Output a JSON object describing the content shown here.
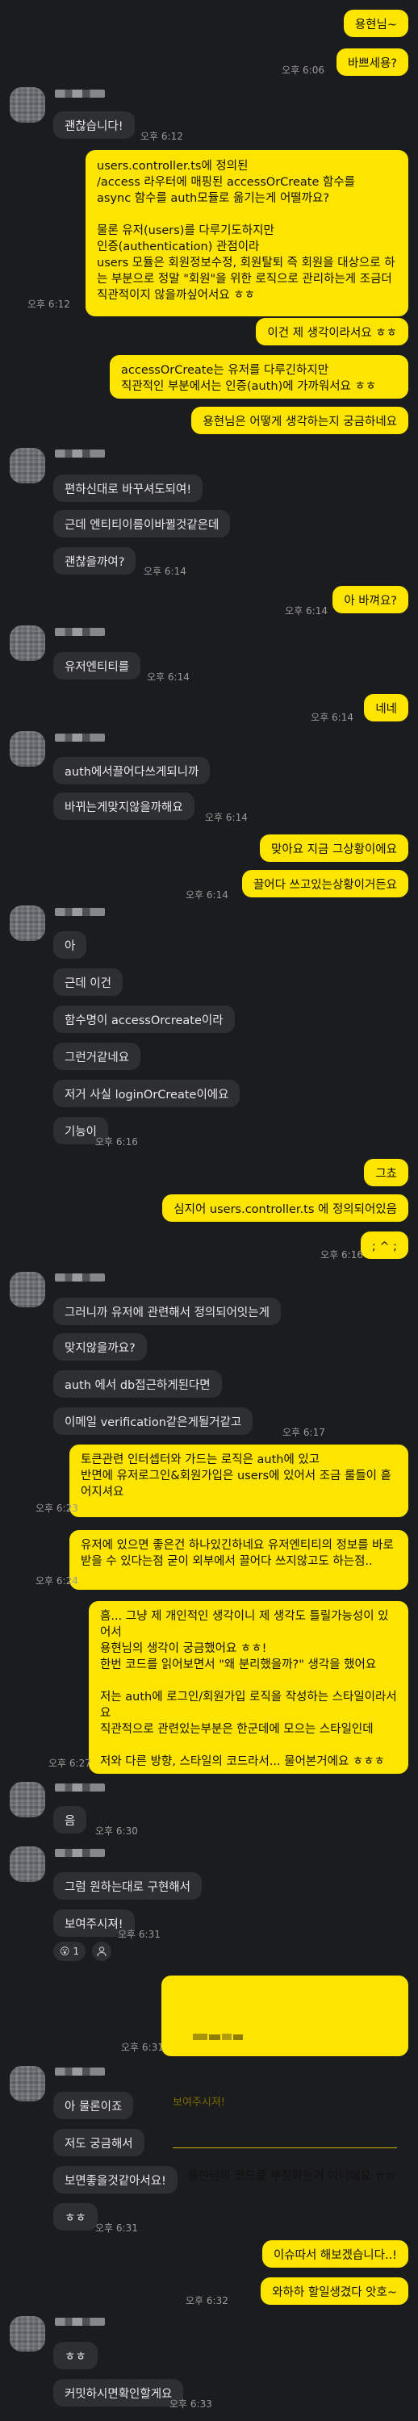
{
  "messages": [
    {
      "sender": "me",
      "text": "용현님~"
    },
    {
      "sender": "me",
      "text": "바쁘세용?",
      "time": "오후 6:06"
    },
    {
      "sender": "them",
      "text": "괜찮습니다!",
      "time": "오후 6:12"
    },
    {
      "sender": "me",
      "text": "users.controller.ts에 정의된\n/access 라우터에 매핑된 accessOrCreate 함수를\nasync 함수를 auth모듈로 옮기는게 어떨까요?\n\n물론 유저(users)를 다루기도하지만\n인증(authentication) 관점이라\nusers 모듈은 회원정보수정, 회원탈퇴 즉 회원을 대상으로 하는 부분으로 정말 \"회원\"을 위한 로직으로 관리하는게 조금더 직관적이지 않을까싶어서요 ㅎㅎ",
      "time": "오후 6:12"
    },
    {
      "sender": "me",
      "text": "이건 제 생각이라서요 ㅎㅎ"
    },
    {
      "sender": "me",
      "text": "accessOrCreate는 유저를 다루긴하지만\n직관적인 부분에서는 인증(auth)에 가까워서요 ㅎㅎ"
    },
    {
      "sender": "me",
      "text": "용현님은 어떻게 생각하는지 궁금하네요"
    },
    {
      "sender": "them",
      "text": "편하신대로 바꾸셔도되여!"
    },
    {
      "sender": "them",
      "text": "근데 엔티티이름이바뀔것같은데"
    },
    {
      "sender": "them",
      "text": "괜찮을까여?",
      "time": "오후 6:14"
    },
    {
      "sender": "me",
      "text": "아 바껴요?",
      "time": "오후 6:14"
    },
    {
      "sender": "them",
      "text": "유저엔티티를",
      "time": "오후 6:14"
    },
    {
      "sender": "me",
      "text": "네네",
      "time": "오후 6:14"
    },
    {
      "sender": "them",
      "text": "auth에서끌어다쓰게되니까"
    },
    {
      "sender": "them",
      "text": "바뀌는게맞지않을까해요",
      "time": "오후 6:14"
    },
    {
      "sender": "me",
      "text": "맞아요 지금 그상황이에요"
    },
    {
      "sender": "me",
      "text": "끌어다 쓰고있는상황이거든요",
      "time": "오후 6:14"
    },
    {
      "sender": "them",
      "text": "아"
    },
    {
      "sender": "them",
      "text": "근데 이건"
    },
    {
      "sender": "them",
      "text": "함수명이 accessOrcreate이라"
    },
    {
      "sender": "them",
      "text": "그런거같네요"
    },
    {
      "sender": "them",
      "text": "저거 사실 loginOrCreate이에요"
    },
    {
      "sender": "them",
      "text": "기능이",
      "time": "오후 6:16"
    },
    {
      "sender": "me",
      "text": "그쵸"
    },
    {
      "sender": "me",
      "text": "심지어 users.controller.ts 에 정의되어있음"
    },
    {
      "sender": "me",
      "text": "; ^ ;",
      "time": "오후 6:16"
    },
    {
      "sender": "them",
      "text": "그러니까 유저에 관련해서 정의되어잇는게"
    },
    {
      "sender": "them",
      "text": "맞지않을까요?"
    },
    {
      "sender": "them",
      "text": "auth 에서 db접근하게된다면"
    },
    {
      "sender": "them",
      "text": "이메일 verification같은게될거같고",
      "time": "오후 6:17"
    },
    {
      "sender": "me",
      "text": "토큰관련 인터셉터와 가드는 로직은 auth에 있고\n반면에 유저로그인&회원가입은 users에 있어서 조금 룰들이 흩어지셔요",
      "time": "오후 6:23"
    },
    {
      "sender": "me",
      "text": "유저에 있으면 좋은건 하나있긴하네요 유저엔티티의 정보를 바로 받을 수 있다는점 굳이 외부에서 끌어다 쓰지않고도 하는점..",
      "time": "오후 6:24"
    },
    {
      "sender": "me",
      "text": "흠... 그냥 제 개인적인 생각이니 제 생각도 틀릴가능성이 있어서\n용현님의 생각이 궁금했어요 ㅎㅎ!\n한번 코드를 읽어보면서 \"왜 분리했을까?\" 생각을 했어요\n\n저는 auth에 로그인/회원가입 로직을 작성하는 스타일이라서요\n직관적으로 관련있는부분은 한군데에 모으는 스타일인데\n\n저와 다른 방향, 스타일의 코드라서... 물어본거에요 ㅎㅎㅎ",
      "time": "오후 6:27"
    },
    {
      "sender": "them",
      "text": "음",
      "time": "오후 6:30"
    },
    {
      "sender": "them",
      "text": "그럼 원하는대로 구현해서"
    },
    {
      "sender": "them",
      "text": "보여주시져!",
      "time": "오후 6:31"
    },
    {
      "sender": "me",
      "quote_sub": "보여주시져!",
      "text": "용현님의 코드를 부정하는거 아니에요 ㅠㅠ",
      "time": "오후 6:31"
    },
    {
      "sender": "them",
      "text": "아 물론이죠"
    },
    {
      "sender": "them",
      "text": "저도 궁금해서"
    },
    {
      "sender": "them",
      "text": "보면좋을것같아서요!"
    },
    {
      "sender": "them",
      "text": "ㅎㅎ",
      "time": "오후 6:31"
    },
    {
      "sender": "me",
      "text": "이슈따서 해보겠습니다..!"
    },
    {
      "sender": "me",
      "text": "와하하 할일생겼다 앗호~",
      "time": "오후 6:32"
    },
    {
      "sender": "them",
      "text": "ㅎㅎ"
    },
    {
      "sender": "them",
      "text": "커밋하시면확인할게요",
      "time": "오후 6:33"
    }
  ],
  "reaction": {
    "emoji": "😮",
    "count": "1"
  },
  "icons": {
    "react_add": "person-add-icon"
  },
  "colors": {
    "background": "#1b1c1e",
    "me_bubble": "#fee500",
    "them_bubble": "#2e2f33"
  }
}
